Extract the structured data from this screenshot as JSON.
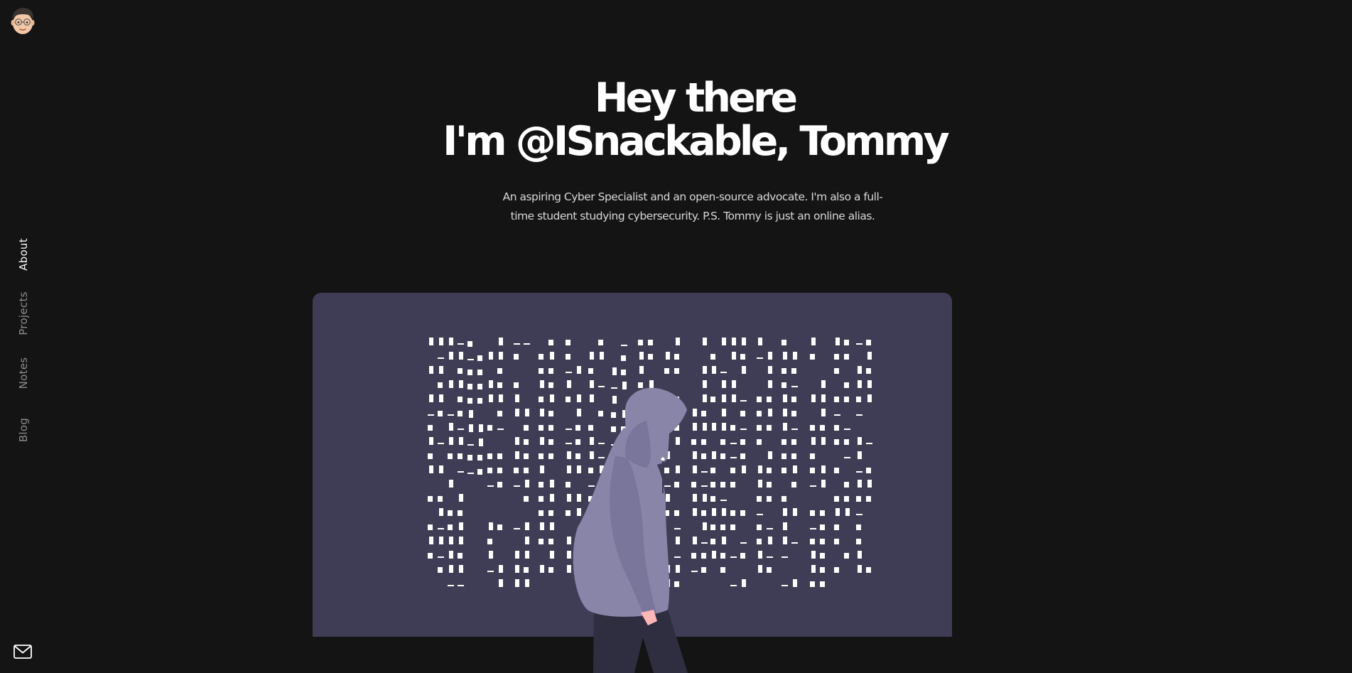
{
  "avatar": {
    "icon": "memoji-avatar-icon"
  },
  "nav": {
    "items": [
      {
        "label": "About",
        "active": true
      },
      {
        "label": "Projects",
        "active": false
      },
      {
        "label": "Notes",
        "active": false
      },
      {
        "label": "Blog",
        "active": false
      }
    ],
    "contact_icon": "mail-icon"
  },
  "hero": {
    "line1": "Hey there",
    "line2": "I'm @ISnackable, Tommy",
    "description": "An aspiring Cyber Specialist and an open-source advocate. I'm also a full-time student studying cybersecurity. P.S. Tommy is just an online alias."
  },
  "colors": {
    "background": "#141414",
    "panel": "#3f3d56",
    "hoodie": "#8985a8",
    "text": "#ffffff",
    "nav_inactive": "#8c8c8c"
  }
}
